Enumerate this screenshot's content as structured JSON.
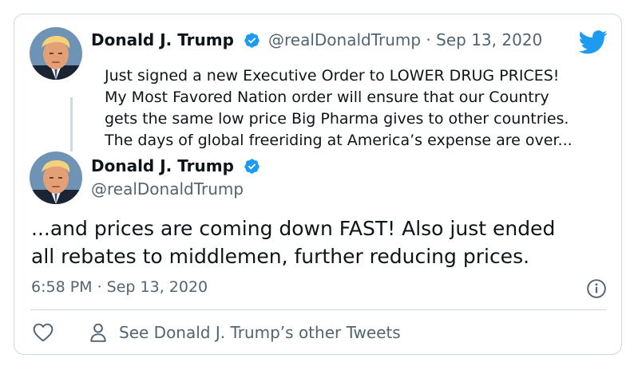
{
  "parent_tweet": {
    "author_name": "Donald J. Trump",
    "handle_and_date": "@realDonaldTrump · Sep 13, 2020",
    "text_lines": [
      "Just signed a new Executive Order to LOWER DRUG PRICES!",
      "My Most Favored Nation order will ensure that our Country",
      "gets the same low price Big Pharma gives to other countries.",
      "The days of global freeriding at America’s expense are over..."
    ]
  },
  "main_tweet": {
    "author_name": "Donald J. Trump",
    "handle": "@realDonaldTrump",
    "text_lines": [
      "...and prices are coming down FAST! Also just ended",
      "all rebates to middlemen, further reducing prices."
    ],
    "timestamp": "6:58 PM · Sep 13, 2020"
  },
  "footer": {
    "other_tweets_label": "See Donald J. Trump’s other Tweets"
  },
  "icons": {
    "brand": "twitter-bird-icon",
    "verified": "verified-badge-icon",
    "info": "info-icon",
    "like": "heart-icon",
    "profile": "person-icon"
  },
  "colors": {
    "brand_blue": "#1d9bf0",
    "text": "#0f1419",
    "secondary": "#536471",
    "border": "#cfd9de"
  }
}
